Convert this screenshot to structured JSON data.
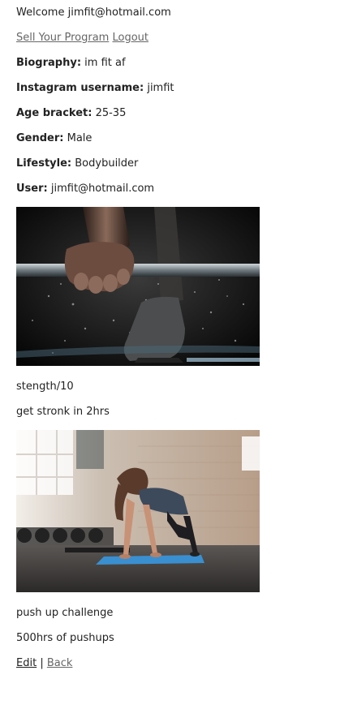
{
  "header": {
    "welcome": "Welcome jimfit@hotmail.com",
    "nav": {
      "sell_label": "Sell Your Program",
      "logout_label": "Logout"
    }
  },
  "profile": {
    "biography": {
      "label": "Biography:",
      "value": "im fit af"
    },
    "instagram": {
      "label": "Instagram username:",
      "value": "jimfit"
    },
    "age": {
      "label": "Age bracket:",
      "value": "25-35"
    },
    "gender": {
      "label": "Gender:",
      "value": "Male"
    },
    "lifestyle": {
      "label": "Lifestyle:",
      "value": "Bodybuilder"
    },
    "user": {
      "label": "User:",
      "value": "jimfit@hotmail.com"
    }
  },
  "programs": [
    {
      "title": "stength/10",
      "description": "get stronk in 2hrs",
      "image_icon": "barbell-deadlift-photo"
    },
    {
      "title": "push up challenge",
      "description": "500hrs of pushups",
      "image_icon": "pushup-gym-photo"
    }
  ],
  "footer": {
    "edit_label": "Edit",
    "separator": "|",
    "back_label": "Back"
  },
  "colors": {
    "text": "#222222",
    "link": "#666666",
    "mat": "#3a8fd0"
  }
}
